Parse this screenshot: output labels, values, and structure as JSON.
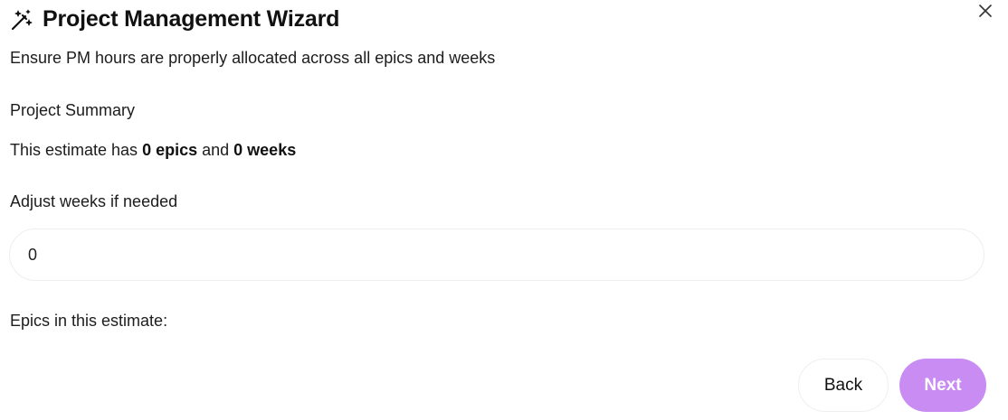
{
  "dialog": {
    "title": "Project Management Wizard",
    "title_icon": "magic-wand-icon",
    "close_icon": "close-icon",
    "subtitle": "Ensure PM hours are properly allocated across all epics and weeks"
  },
  "summary": {
    "heading": "Project Summary",
    "text_prefix": "This estimate has ",
    "epics_count": "0 epics",
    "text_middle": " and ",
    "weeks_count": "0 weeks"
  },
  "weeks": {
    "label": "Adjust weeks if needed",
    "value": "0"
  },
  "epics": {
    "label": "Epics in this estimate:"
  },
  "actions": {
    "back_label": "Back",
    "next_label": "Next"
  },
  "colors": {
    "accent": "#c98cf3",
    "text": "#111111"
  }
}
